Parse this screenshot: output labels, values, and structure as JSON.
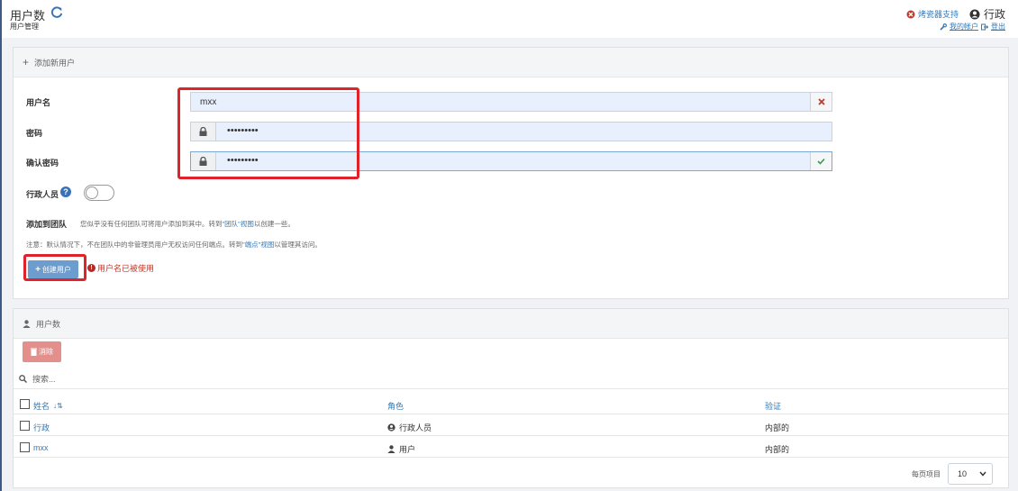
{
  "header": {
    "title": "用户数",
    "subtitle": "用户管理",
    "support_label": "烤瓷器支持",
    "username": "行政",
    "account_link": "我的帐户",
    "logout_link": "登出"
  },
  "add_user": {
    "section_title": "添加新用户",
    "username_label": "用户名",
    "username_value": "mxx",
    "password_label": "密码",
    "password_value": "•••••••••",
    "confirm_label": "确认密码",
    "confirm_value": "•••••••••",
    "admin_label": "行政人员",
    "team_label": "添加到团队",
    "team_note_pre": "您似乎没有任何团队可将用户添加到其中。转到",
    "team_note_link": "\"团队\"视图",
    "team_note_post": "以创建一些。",
    "access_note_pre": "注意：默认情况下，不在团队中的非管理员用户无权访问任何端点。转到",
    "access_note_link": "\"端点\"视图",
    "access_note_post": "以管理其访问。",
    "create_button": "创建用户",
    "error_message": "用户名已被使用"
  },
  "users_table": {
    "section_title": "用户数",
    "delete_button": "消除",
    "search_placeholder": "搜索...",
    "columns": [
      "姓名",
      "角色",
      "验证"
    ],
    "rows": [
      {
        "name": "行政",
        "role": "行政人员",
        "auth": "内部的"
      },
      {
        "name": "mxx",
        "role": "用户",
        "auth": "内部的"
      }
    ],
    "per_page_label": "每页项目",
    "per_page_value": "10"
  },
  "colors": {
    "highlight_box": "#e0232b",
    "link": "#337ab7",
    "create_button": "#6d9ccf",
    "delete_button": "#e58f8d"
  }
}
